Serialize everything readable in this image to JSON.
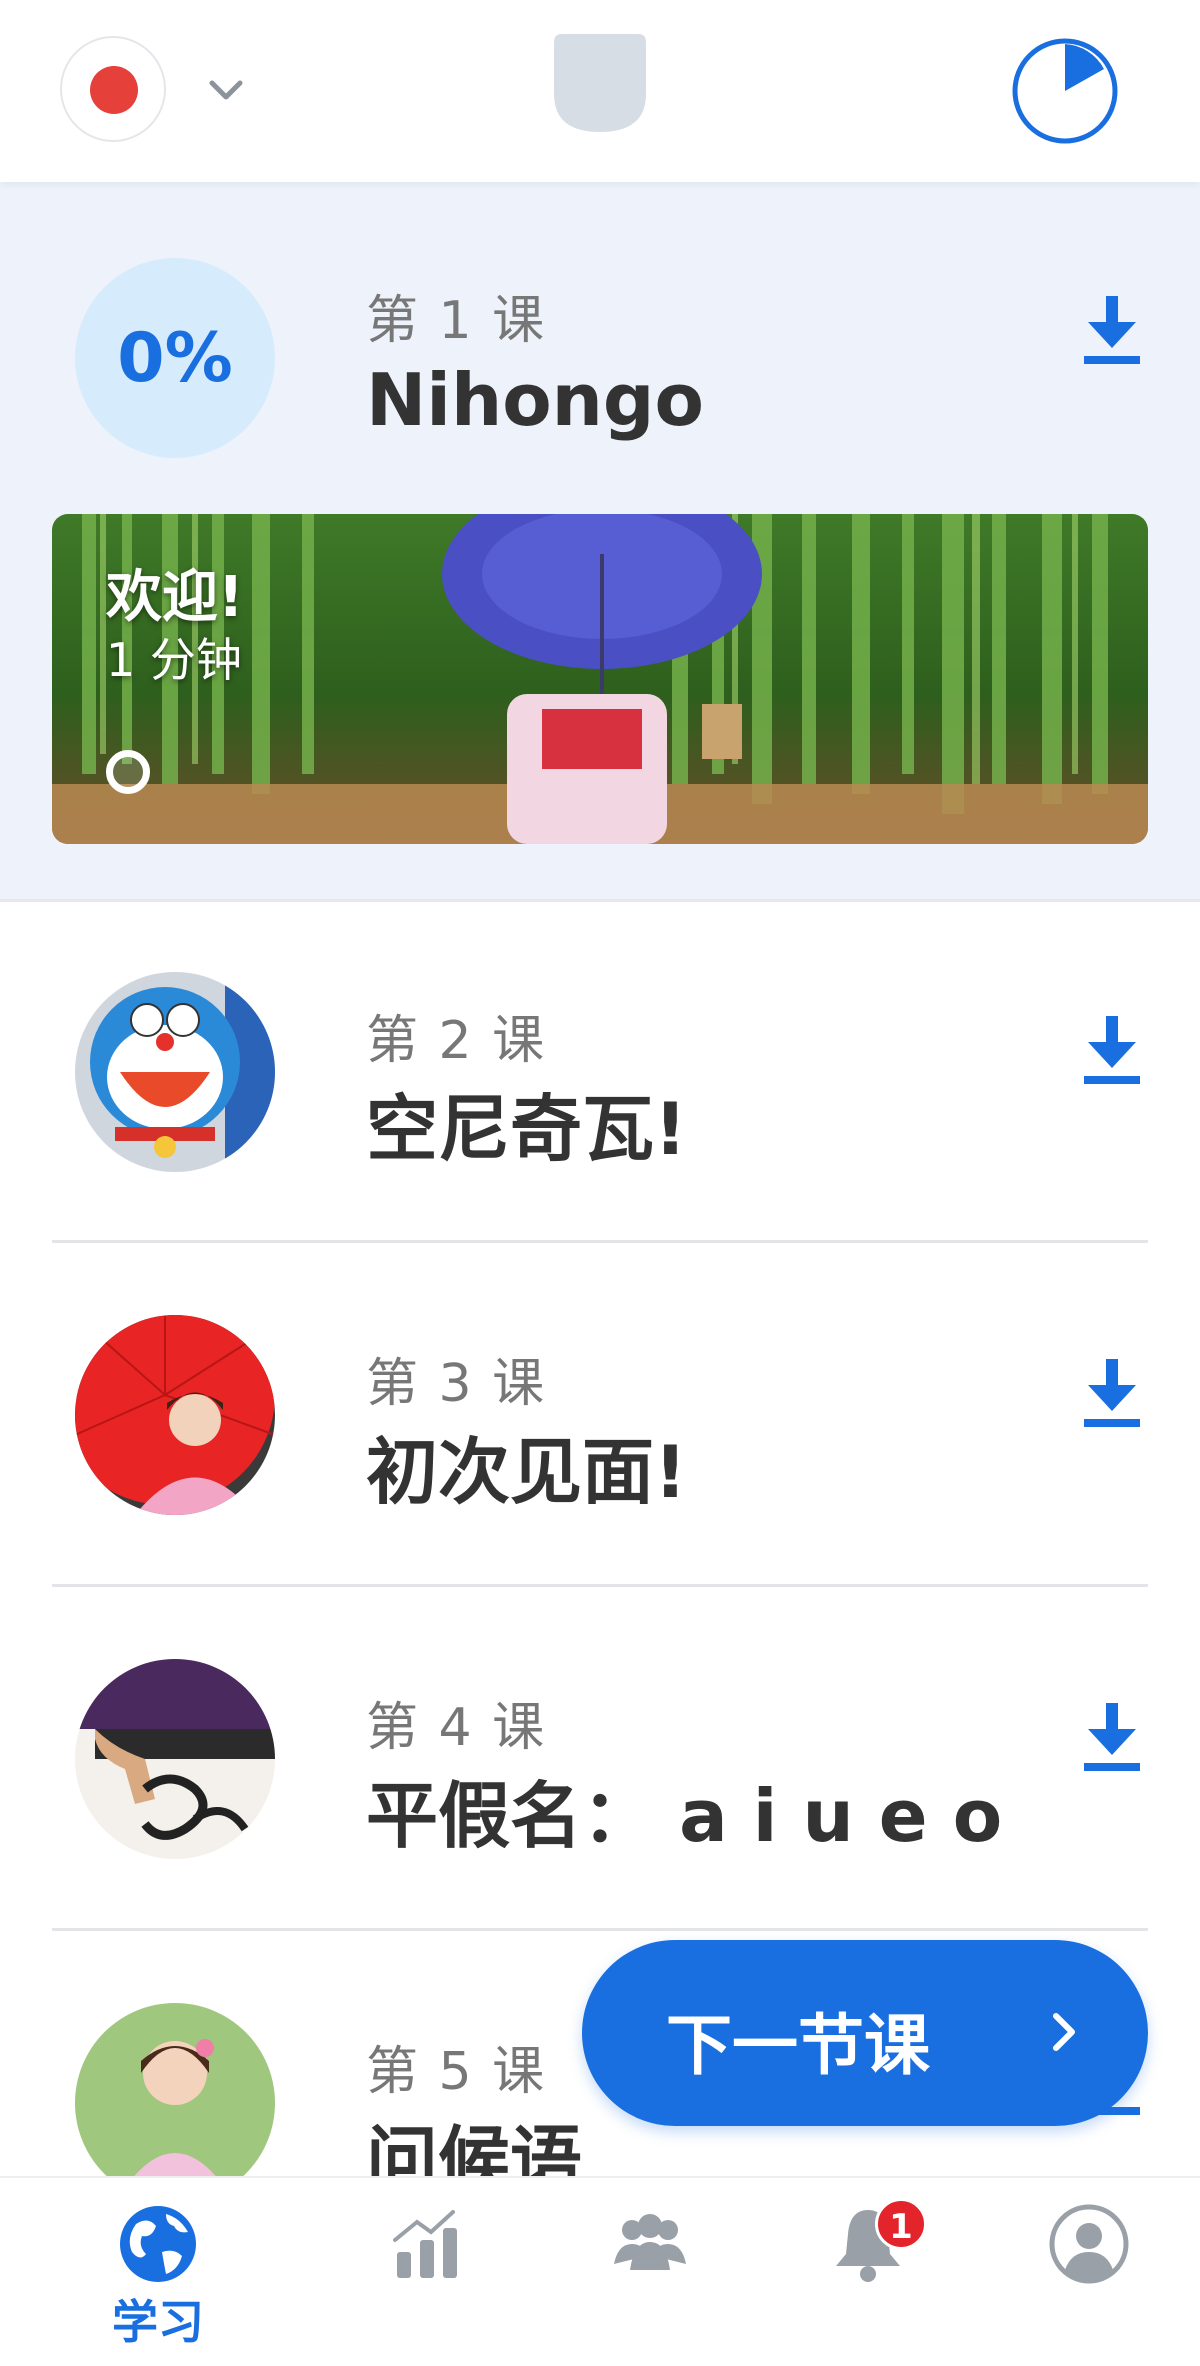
{
  "colors": {
    "accent": "#1a6fe0",
    "badge": "#e3242b",
    "muted": "#9aa0a8"
  },
  "topbar": {
    "language_flag_icon": "japan-flag-icon",
    "language_dropdown_icon": "chevron-down-icon",
    "streak_icon": "shield-icon",
    "daily_goal_icon": "pie-timer-icon"
  },
  "lesson1": {
    "progress_label": "0%",
    "progress": 0,
    "number_label": "第 1 课",
    "title": "Nihongo",
    "download_icon": "download-icon",
    "banner": {
      "title": "欢迎!",
      "duration": "1 分钟"
    }
  },
  "lessons": [
    {
      "number_label": "第 2 课",
      "title": "空尼奇瓦!"
    },
    {
      "number_label": "第 3 课",
      "title": "初次见面!"
    },
    {
      "number_label": "第 4 课",
      "title": "平假名： a i u e o"
    },
    {
      "number_label": "第 5 课",
      "title": "问候语"
    }
  ],
  "cta": {
    "label": "下一节课",
    "icon": "chevron-right-icon"
  },
  "bottom_nav": {
    "learn_label": "学习",
    "notification_count": "1",
    "items": [
      "globe-icon",
      "stats-icon",
      "community-icon",
      "bell-icon",
      "profile-icon"
    ]
  }
}
